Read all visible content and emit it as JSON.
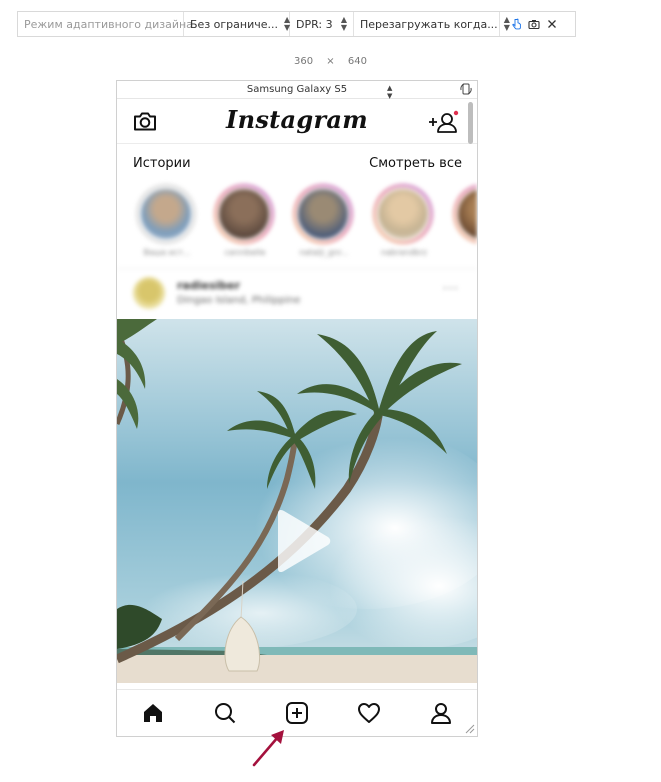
{
  "devtools": {
    "mode_label": "Режим адаптивного дизайна",
    "throttling_label": "Без ограниче...",
    "dpr_label": "DPR: 3",
    "reload_label": "Перезагружать когда...",
    "width": "360",
    "times": "×",
    "height": "640",
    "device_name": "Samsung Galaxy S5",
    "icons": [
      "touch-icon",
      "camera-icon",
      "close-icon",
      "rotate-icon"
    ]
  },
  "instagram": {
    "logo": "Instagram",
    "stories_title": "Истории",
    "watch_all": "Смотреть все",
    "stories": [
      {
        "name": "Ваша ист..."
      },
      {
        "name": "cannibelle"
      },
      {
        "name": "natalji_gnr..."
      },
      {
        "name": "nabrandbrz"
      },
      {
        "name": "..."
      }
    ],
    "post": {
      "user": "radiesiber",
      "location": "Dingao Island, Philippine",
      "more": "···"
    },
    "nav_icons": [
      "home-icon",
      "search-icon",
      "add-post-icon",
      "heart-icon",
      "profile-icon"
    ]
  },
  "colors": {
    "accent_arrow": "#a4113d",
    "notification_dot": "#e0304f",
    "touch_icon": "#1a73e8"
  }
}
